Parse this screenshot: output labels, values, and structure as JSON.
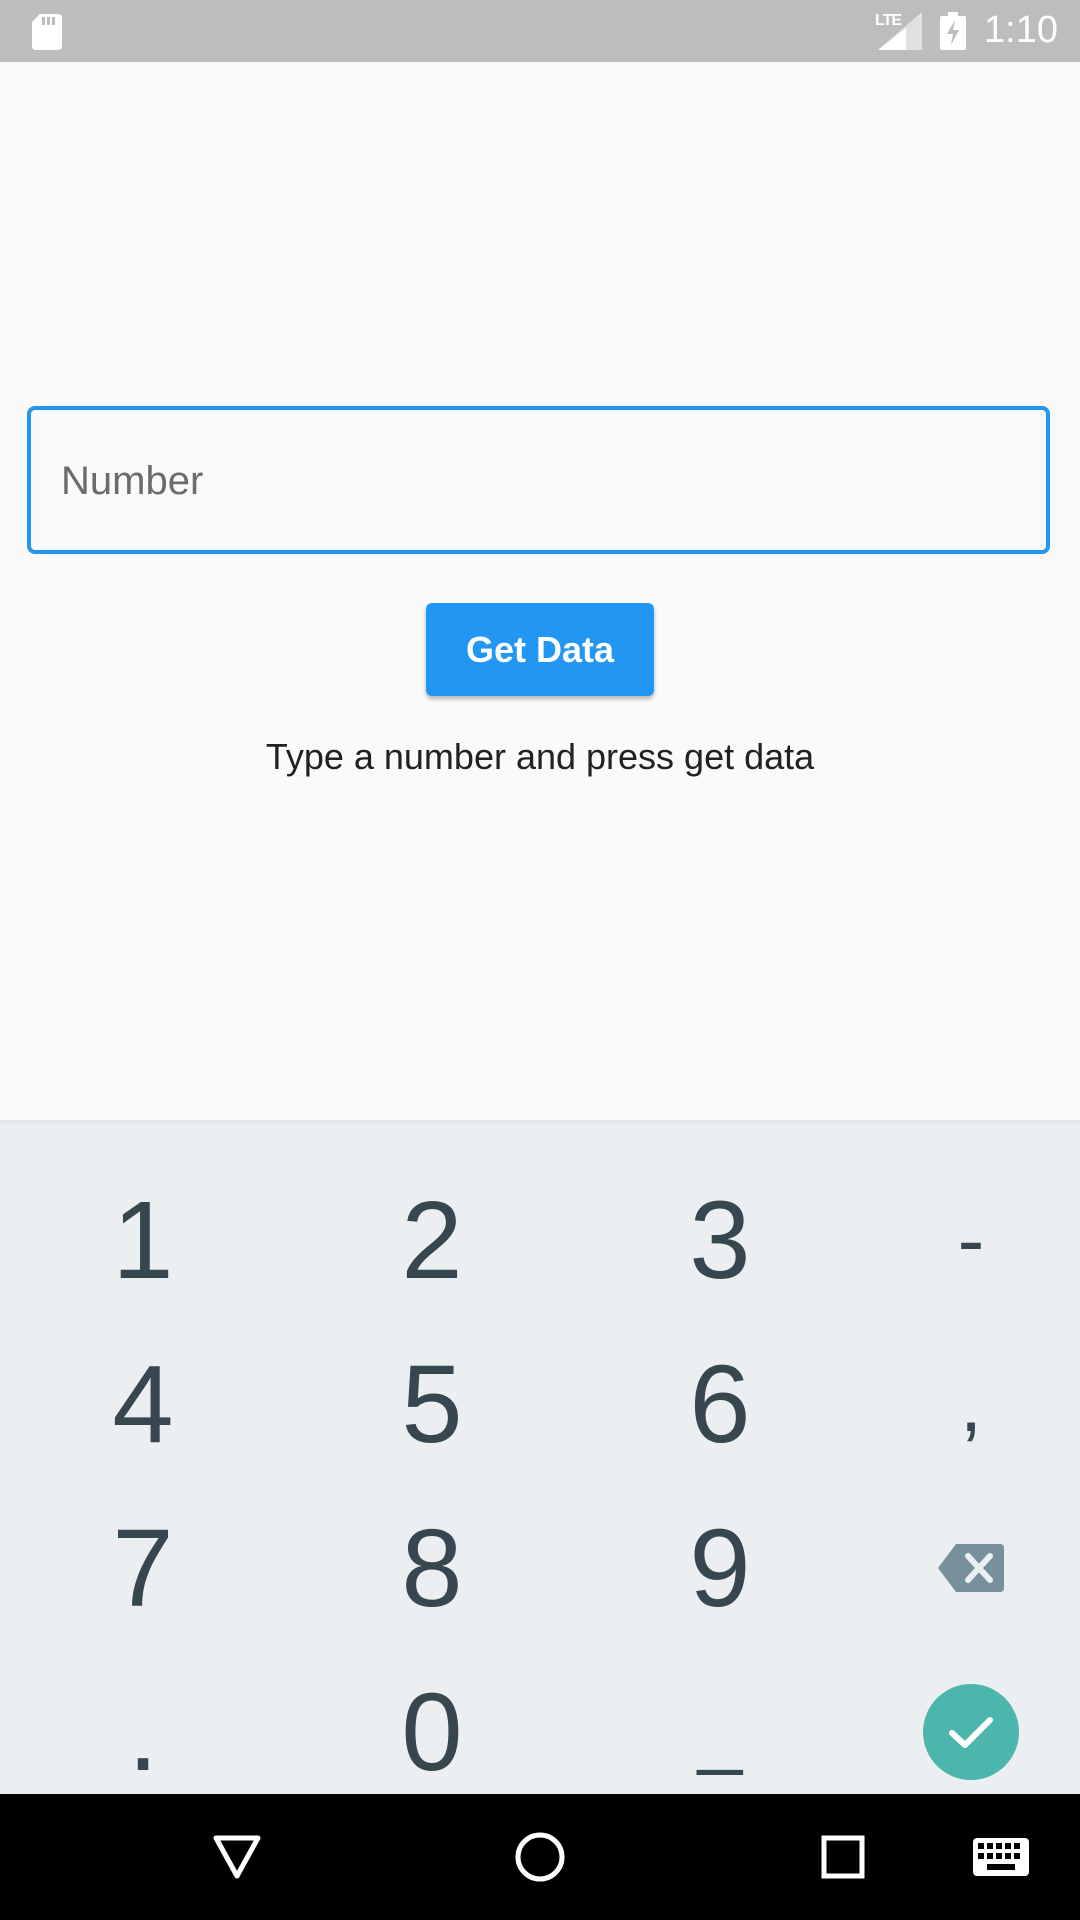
{
  "status_bar": {
    "time": "1:10",
    "network": "LTE",
    "icons": [
      "sd-card-icon",
      "signal-icon",
      "battery-charging-icon"
    ]
  },
  "form": {
    "input_placeholder": "Number",
    "input_value": "",
    "button_label": "Get Data",
    "hint": "Type a number and press get data",
    "accent_color": "#2196f3"
  },
  "keyboard": {
    "keys": [
      [
        "1",
        "2",
        "3",
        "-"
      ],
      [
        "4",
        "5",
        "6",
        ","
      ],
      [
        "7",
        "8",
        "9",
        "backspace-icon"
      ],
      [
        ".",
        "0",
        "_",
        "done-check-icon"
      ]
    ],
    "done_color": "#4db6ac"
  },
  "nav_bar": {
    "icons": [
      "back-icon",
      "home-icon",
      "recents-icon",
      "keyboard-icon"
    ]
  }
}
